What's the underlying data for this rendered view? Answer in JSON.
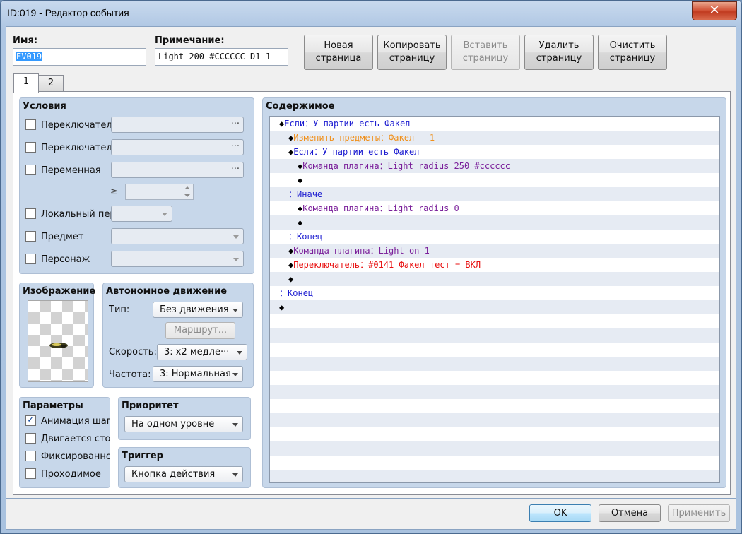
{
  "window": {
    "title": "ID:019 - Редактор события",
    "close_glyph": "✕"
  },
  "name": {
    "label": "Имя:",
    "value": "EV019"
  },
  "note": {
    "label": "Примечание:",
    "value": "Light 200 #CCCCCC D1 1"
  },
  "page_buttons": [
    {
      "line1": "Новая",
      "line2": "страница",
      "enabled": true
    },
    {
      "line1": "Копировать",
      "line2": "страницу",
      "enabled": true
    },
    {
      "line1": "Вставить",
      "line2": "страницу",
      "enabled": false
    },
    {
      "line1": "Удалить",
      "line2": "страницу",
      "enabled": true
    },
    {
      "line1": "Очистить",
      "line2": "страницу",
      "enabled": true
    }
  ],
  "tabs": [
    {
      "label": "1",
      "active": true
    },
    {
      "label": "2",
      "active": false
    }
  ],
  "conditions": {
    "title": "Условия",
    "switch1": "Переключатель",
    "switch2": "Переключатель",
    "variable": "Переменная",
    "ge": "≥",
    "self_switch": "Локальный пер",
    "item": "Предмет",
    "actor": "Персонаж",
    "dots": "···"
  },
  "image": {
    "title": "Изображение",
    "icon": "torch-sprite-icon"
  },
  "movement": {
    "title": "Автономное движение",
    "type_label": "Тип:",
    "type_value": "Без движения",
    "route_button": "Маршрут...",
    "speed_label": "Скорость:",
    "speed_value": "3: x2 медле···",
    "freq_label": "Частота:",
    "freq_value": "3: Нормальная"
  },
  "options": {
    "title": "Параметры",
    "items": [
      {
        "label": "Анимация шага",
        "checked": true
      },
      {
        "label": "Двигается стоя",
        "checked": false
      },
      {
        "label": "Фиксированное",
        "checked": false
      },
      {
        "label": "Проходимое",
        "checked": false
      }
    ],
    "check_glyph": "✓"
  },
  "priority": {
    "title": "Приоритет",
    "value": "На одном уровне"
  },
  "trigger": {
    "title": "Триггер",
    "value": "Кнопка действия"
  },
  "contents": {
    "title": "Содержимое",
    "rows": [
      {
        "prefix": "◆",
        "text": "Если：У партии есть Факел",
        "color": "blue",
        "indent": 0
      },
      {
        "prefix": "◆",
        "text": "Изменить предметы：Факел - 1",
        "color": "orange",
        "indent": 1
      },
      {
        "prefix": "◆",
        "text": "Если：У партии есть Факел",
        "color": "blue",
        "indent": 1
      },
      {
        "prefix": "◆",
        "text": "Команда плагина：Light radius 250 #cccccc",
        "color": "purple",
        "indent": 2
      },
      {
        "prefix": "◆",
        "text": "",
        "color": "blue",
        "indent": 2
      },
      {
        "prefix": "：",
        "text": "Иначе",
        "color": "blue",
        "indent": 1
      },
      {
        "prefix": "◆",
        "text": "Команда плагина：Light radius 0",
        "color": "purple",
        "indent": 2
      },
      {
        "prefix": "◆",
        "text": "",
        "color": "blue",
        "indent": 2
      },
      {
        "prefix": "：",
        "text": "Конец",
        "color": "blue",
        "indent": 1
      },
      {
        "prefix": "◆",
        "text": "Команда плагина：Light on 1",
        "color": "purple",
        "indent": 1
      },
      {
        "prefix": "◆",
        "text": "Переключатель：#0141 Факел тест = ВКЛ",
        "color": "red",
        "indent": 1
      },
      {
        "prefix": "◆",
        "text": "",
        "color": "blue",
        "indent": 1
      },
      {
        "prefix": "：",
        "text": "Конец",
        "color": "blue",
        "indent": 0
      },
      {
        "prefix": "◆",
        "text": "",
        "color": "blue",
        "indent": 0
      }
    ]
  },
  "footer": {
    "ok": "OK",
    "cancel": "Отмена",
    "apply": "Применить"
  }
}
